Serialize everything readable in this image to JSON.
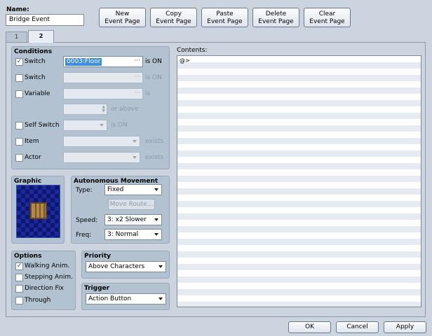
{
  "name": {
    "label": "Name:",
    "value": "Bridge Event"
  },
  "page_buttons": {
    "new": "New\nEvent Page",
    "copy": "Copy\nEvent Page",
    "paste": "Paste\nEvent Page",
    "delete": "Delete\nEvent Page",
    "clear": "Clear\nEvent Page"
  },
  "tabs": [
    "1",
    "2"
  ],
  "conditions": {
    "title": "Conditions",
    "switch1": {
      "label": "Switch",
      "checked": true,
      "value": "0003:Floor",
      "suffix": "is ON"
    },
    "switch2": {
      "label": "Switch",
      "checked": false,
      "value": "",
      "suffix": "is ON"
    },
    "variable": {
      "label": "Variable",
      "checked": false,
      "value": "",
      "suffix": "is",
      "compare": "or above"
    },
    "self_switch": {
      "label": "Self Switch",
      "checked": false,
      "suffix": "is ON"
    },
    "item": {
      "label": "Item",
      "checked": false,
      "suffix": "exists"
    },
    "actor": {
      "label": "Actor",
      "checked": false,
      "suffix": "exists"
    }
  },
  "graphic": {
    "title": "Graphic"
  },
  "autonomous": {
    "title": "Autonomous Movement",
    "type_label": "Type:",
    "type_value": "Fixed",
    "move_route": "Move Route...",
    "speed_label": "Speed:",
    "speed_value": "3: x2 Slower",
    "freq_label": "Freq:",
    "freq_value": "3: Normal"
  },
  "options": {
    "title": "Options",
    "walking": {
      "label": "Walking Anim.",
      "checked": true
    },
    "stepping": {
      "label": "Stepping Anim.",
      "checked": false
    },
    "direction_fix": {
      "label": "Direction Fix",
      "checked": false
    },
    "through": {
      "label": "Through",
      "checked": false
    }
  },
  "priority": {
    "title": "Priority",
    "value": "Above Characters"
  },
  "trigger": {
    "title": "Trigger",
    "value": "Action Button"
  },
  "contents": {
    "label": "Contents:",
    "first_line": "@>"
  },
  "footer": {
    "ok": "OK",
    "cancel": "Cancel",
    "apply": "Apply"
  },
  "check_glyph": "✓",
  "colors": {
    "selection": "#3d8ee0",
    "panel": "#b3c2d1",
    "background": "#ccd5df"
  }
}
